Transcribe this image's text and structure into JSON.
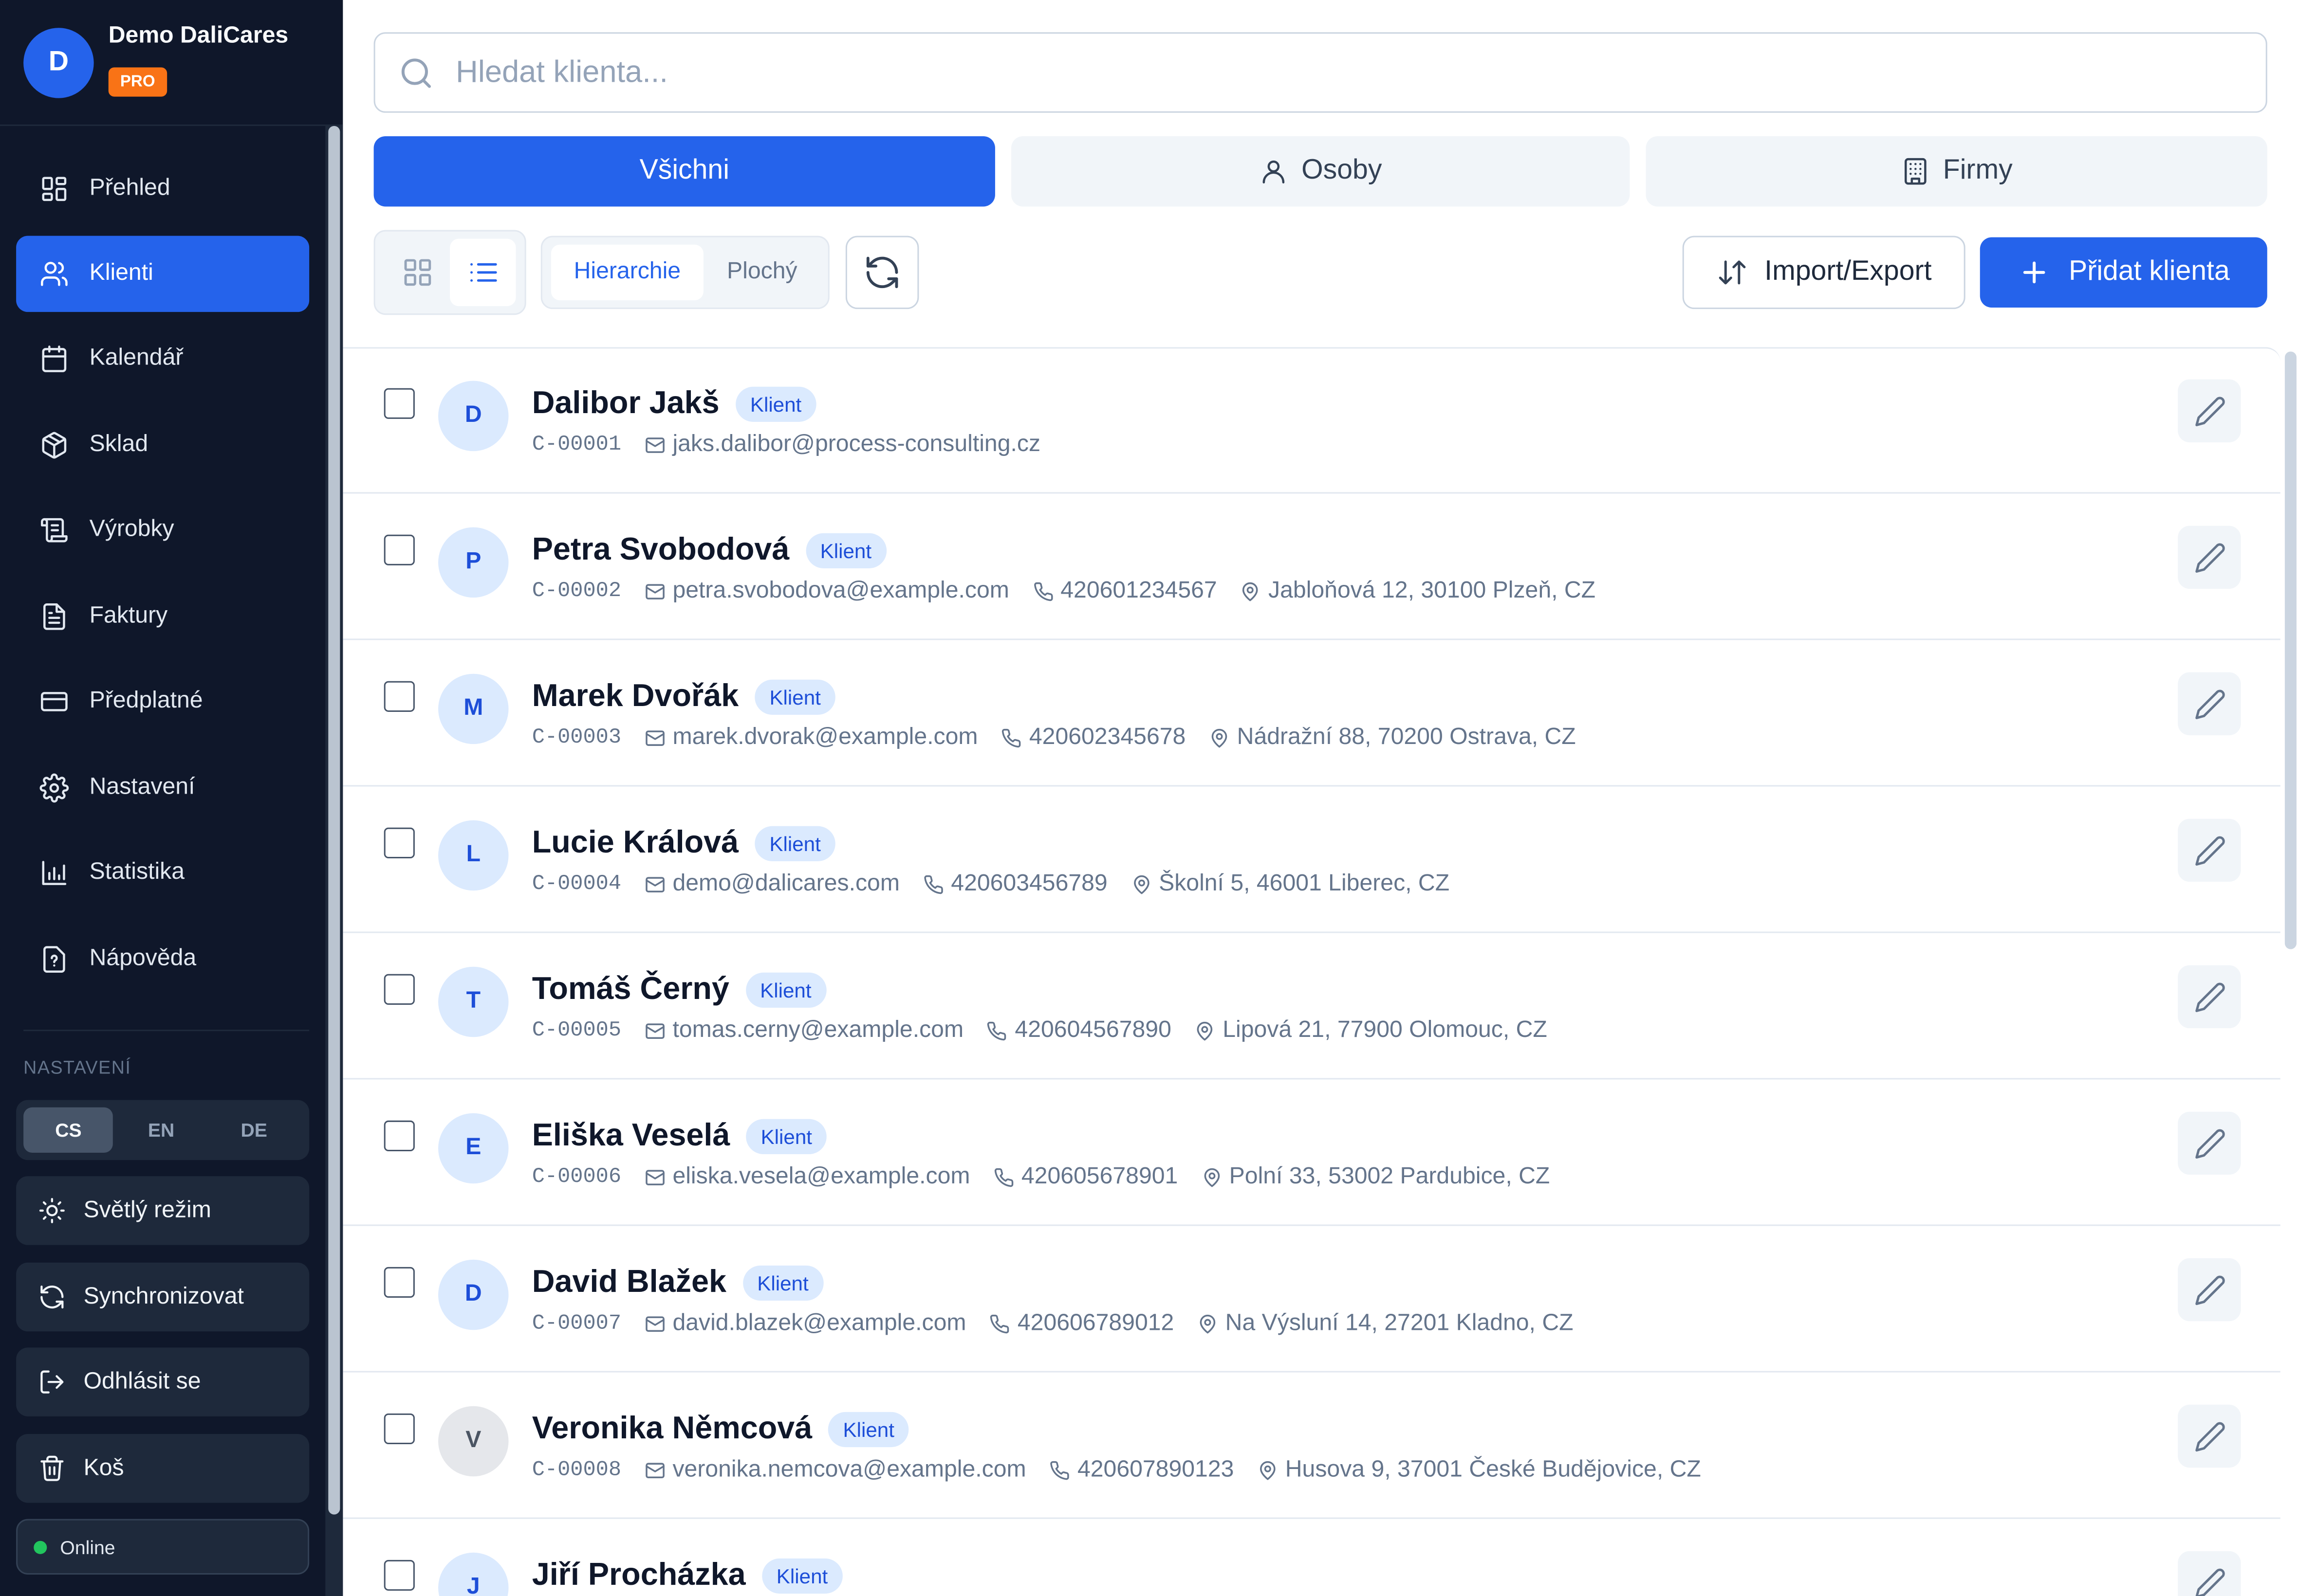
{
  "brand": {
    "name": "Demo DaliCares",
    "initial": "D",
    "badge": "PRO"
  },
  "nav": [
    {
      "label": "Přehled",
      "icon": "grid-icon",
      "active": false
    },
    {
      "label": "Klienti",
      "icon": "users-icon",
      "active": true
    },
    {
      "label": "Kalendář",
      "icon": "calendar-icon",
      "active": false
    },
    {
      "label": "Sklad",
      "icon": "package-icon",
      "active": false
    },
    {
      "label": "Výrobky",
      "icon": "scroll-icon",
      "active": false
    },
    {
      "label": "Faktury",
      "icon": "file-text-icon",
      "active": false
    },
    {
      "label": "Předplatné",
      "icon": "credit-card-icon",
      "active": false
    },
    {
      "label": "Nastavení",
      "icon": "gear-icon",
      "active": false
    },
    {
      "label": "Statistika",
      "icon": "bar-chart-icon",
      "active": false
    },
    {
      "label": "Nápověda",
      "icon": "help-icon",
      "active": false
    }
  ],
  "settings": {
    "section_label": "NASTAVENÍ",
    "languages": [
      "CS",
      "EN",
      "DE"
    ],
    "active_language": "CS",
    "theme_label": "Světlý režim",
    "sync_label": "Synchronizovat",
    "logout_label": "Odhlásit se",
    "trash_label": "Koš",
    "status_label": "Online",
    "status_color": "#22c55e"
  },
  "search": {
    "placeholder": "Hledat klienta...",
    "value": ""
  },
  "tabs": [
    {
      "label": "Všichni",
      "icon": "",
      "active": true
    },
    {
      "label": "Osoby",
      "icon": "user-icon",
      "active": false
    },
    {
      "label": "Firmy",
      "icon": "building-icon",
      "active": false
    }
  ],
  "toolbar": {
    "view_modes": [
      "grid-view-icon",
      "list-view-icon"
    ],
    "active_view": "list",
    "hierarchy_label": "Hierarchie",
    "flat_label": "Plochý",
    "active_mode": "Hierarchie",
    "import_export_label": "Import/Export",
    "add_label": "Přidat klienta"
  },
  "colors": {
    "accent": "#2563eb",
    "sidebar": "#0f172a",
    "pro_badge": "#f97316"
  },
  "clients": [
    {
      "initial": "D",
      "name": "Dalibor Jakš",
      "badge": "Klient",
      "code": "C-00001",
      "email": "jaks.dalibor@process-consulting.cz",
      "phone": "",
      "address": ""
    },
    {
      "initial": "P",
      "name": "Petra Svobodová",
      "badge": "Klient",
      "code": "C-00002",
      "email": "petra.svobodova@example.com",
      "phone": "420601234567",
      "address": "Jabloňová 12, 30100 Plzeň, CZ"
    },
    {
      "initial": "M",
      "name": "Marek Dvořák",
      "badge": "Klient",
      "code": "C-00003",
      "email": "marek.dvorak@example.com",
      "phone": "420602345678",
      "address": "Nádražní 88, 70200 Ostrava, CZ"
    },
    {
      "initial": "L",
      "name": "Lucie Králová",
      "badge": "Klient",
      "code": "C-00004",
      "email": "demo@dalicares.com",
      "phone": "420603456789",
      "address": "Školní 5, 46001 Liberec, CZ"
    },
    {
      "initial": "T",
      "name": "Tomáš Černý",
      "badge": "Klient",
      "code": "C-00005",
      "email": "tomas.cerny@example.com",
      "phone": "420604567890",
      "address": "Lipová 21, 77900 Olomouc, CZ"
    },
    {
      "initial": "E",
      "name": "Eliška Veselá",
      "badge": "Klient",
      "code": "C-00006",
      "email": "eliska.vesela@example.com",
      "phone": "420605678901",
      "address": "Polní 33, 53002 Pardubice, CZ"
    },
    {
      "initial": "D",
      "name": "David Blažek",
      "badge": "Klient",
      "code": "C-00007",
      "email": "david.blazek@example.com",
      "phone": "420606789012",
      "address": "Na Výsluní 14, 27201 Kladno, CZ"
    },
    {
      "initial": "V",
      "name": "Veronika Němcová",
      "badge": "Klient",
      "code": "C-00008",
      "email": "veronika.nemcova@example.com",
      "phone": "420607890123",
      "address": "Husova 9, 37001 České Budějovice, CZ"
    },
    {
      "initial": "J",
      "name": "Jiří Procházka",
      "badge": "Klient",
      "code": "",
      "email": "",
      "phone": "",
      "address": ""
    }
  ]
}
